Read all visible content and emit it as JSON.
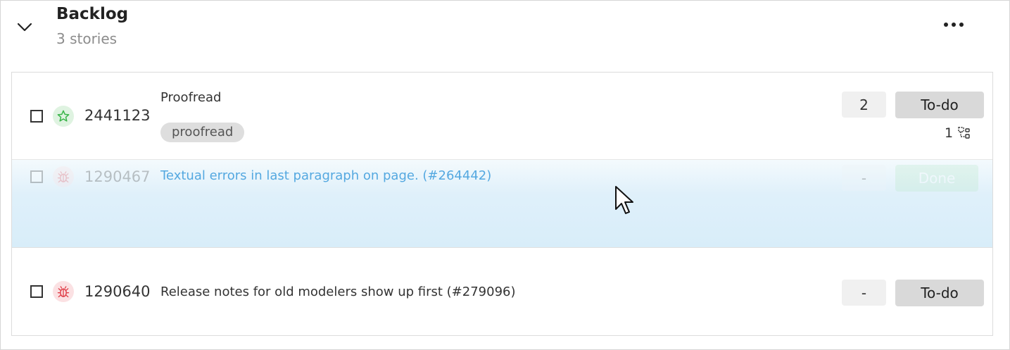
{
  "section": {
    "title": "Backlog",
    "subtitle": "3 stories"
  },
  "icons": {
    "collapse": "chevron-down-icon",
    "more": "more-horizontal-icon",
    "story": "star-icon",
    "bug": "bug-icon",
    "subtasks": "subtasks-icon"
  },
  "colors": {
    "story_icon": "#3bb54a",
    "bug_icon": "#e0404a",
    "drag_highlight": "#d8edf9",
    "link_title": "#3a9bdc"
  },
  "stories": [
    {
      "id": "2441123",
      "type": "story",
      "title": "Proofread",
      "tag": "proofread",
      "points": "2",
      "status": "To-do",
      "subtasks": "1"
    },
    {
      "id": "1290467",
      "type": "bug",
      "title": "Textual errors in last paragraph on page. (#264442)",
      "points": "-",
      "status": "Done",
      "dragging": true
    },
    {
      "id": "1290640",
      "type": "bug",
      "title": "Release notes for old modelers show up first (#279096)",
      "points": "-",
      "status": "To-do"
    }
  ]
}
